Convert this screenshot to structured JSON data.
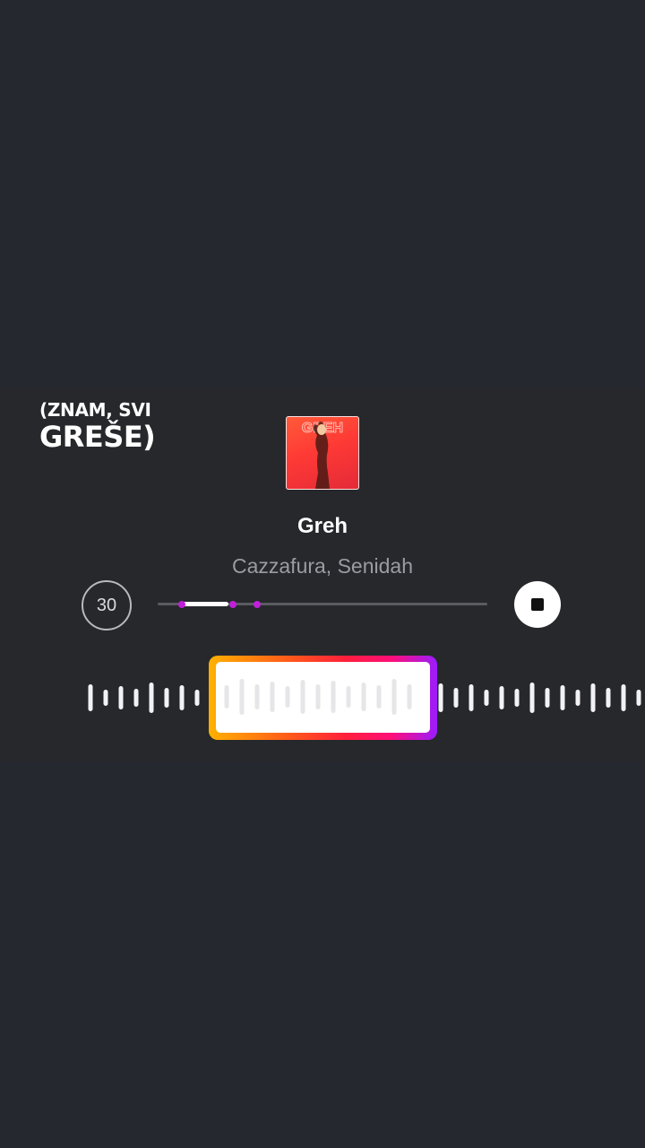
{
  "lyrics": {
    "line1": "(ZNAM, SVI",
    "line2": "GREŠE)"
  },
  "track": {
    "title": "Greh",
    "artist": "Cazzafura, Senidah",
    "cover_text": "GREH"
  },
  "controls": {
    "duration_label": "30",
    "progress_fraction": 0.14,
    "stop_icon": "stop-icon"
  },
  "colors": {
    "background": "#262830",
    "accent_magenta": "#c020d8",
    "selector_gradient": [
      "#ffb100",
      "#ff1f3c",
      "#ff0e78",
      "#9a1cff"
    ]
  }
}
